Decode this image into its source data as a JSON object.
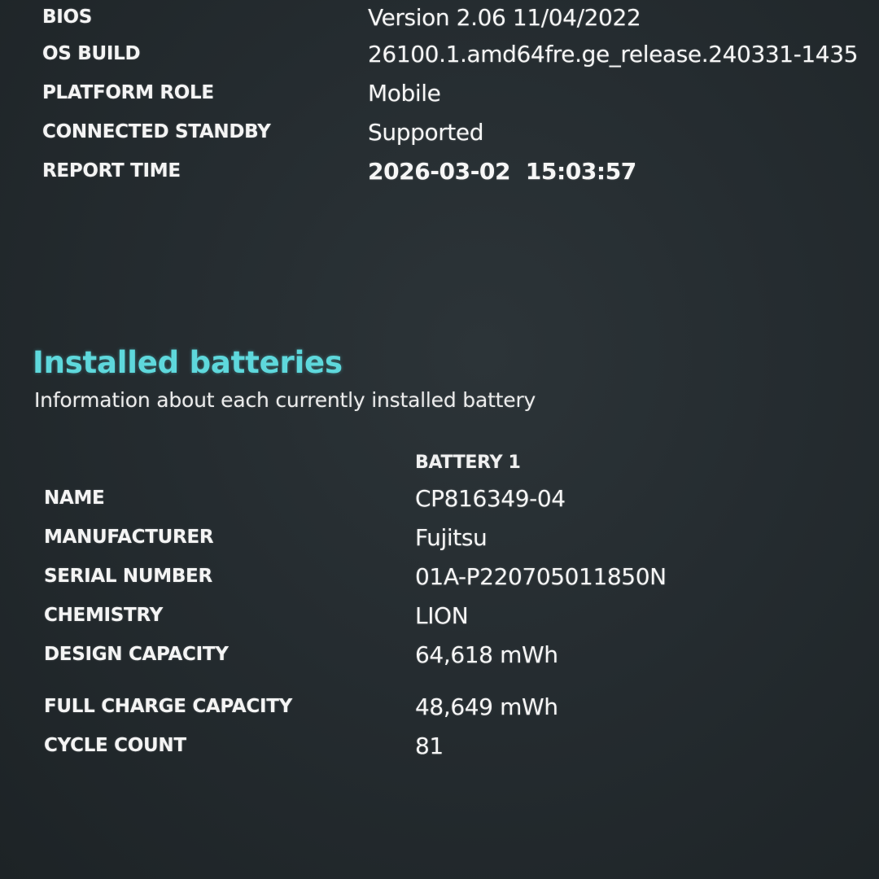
{
  "system_info": [
    {
      "label": "BIOS",
      "value": "Version 2.06 11/04/2022"
    },
    {
      "label": "OS BUILD",
      "value": "26100.1.amd64fre.ge_release.240331-1435"
    },
    {
      "label": "PLATFORM ROLE",
      "value": "Mobile"
    },
    {
      "label": "CONNECTED STANDBY",
      "value": "Supported"
    },
    {
      "label": "REPORT TIME",
      "value": "2026-03-02  15:03:57"
    }
  ],
  "installed_batteries": {
    "title": "Installed batteries",
    "subtitle": "Information about each currently installed battery",
    "column_header": "BATTERY 1",
    "rows": [
      {
        "label": "NAME",
        "value": "CP816349-04"
      },
      {
        "label": "MANUFACTURER",
        "value": "Fujitsu"
      },
      {
        "label": "SERIAL NUMBER",
        "value": "01A-P220705011850N"
      },
      {
        "label": "CHEMISTRY",
        "value": "LION"
      },
      {
        "label": "DESIGN CAPACITY",
        "value": "64,618 mWh"
      },
      {
        "label": "FULL CHARGE CAPACITY",
        "value": "48,649 mWh"
      },
      {
        "label": "CYCLE COUNT",
        "value": "81"
      }
    ]
  },
  "colors": {
    "background": "#252c30",
    "heading_accent": "#5ed8dc",
    "text": "#f4f4f4"
  }
}
